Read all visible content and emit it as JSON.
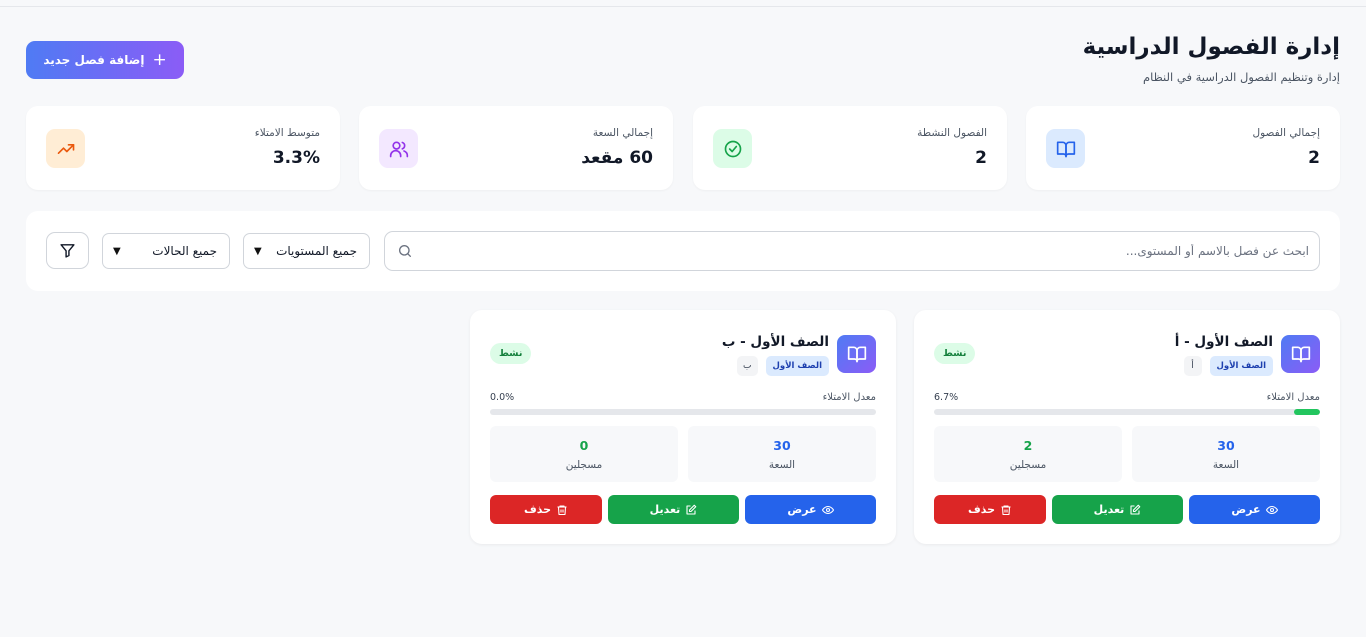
{
  "header": {
    "title": "إدارة الفصول الدراسية",
    "subtitle": "إدارة وتنظيم الفصول الدراسية في النظام",
    "add_button_label": "إضافة فصل جديد"
  },
  "stats": [
    {
      "label": "إجمالي الفصول",
      "value": "2",
      "icon": "book-open-icon",
      "color": "#2563eb",
      "bg": "#dbeafe"
    },
    {
      "label": "الفصول النشطة",
      "value": "2",
      "icon": "check-circle-icon",
      "color": "#16a34a",
      "bg": "#dcfce7"
    },
    {
      "label": "إجمالي السعة",
      "value": "60 مقعد",
      "icon": "users-icon",
      "color": "#9333ea",
      "bg": "#f3e8ff"
    },
    {
      "label": "متوسط الامتلاء",
      "value": "3.3%",
      "icon": "trending-up-icon",
      "color": "#ea580c",
      "bg": "#ffedd5"
    }
  ],
  "filters": {
    "search_placeholder": "ابحث عن فصل بالاسم أو المستوى...",
    "level_select": "جميع المستويات",
    "status_select": "جميع الحالات"
  },
  "classes": [
    {
      "name": "الصف الأول - أ",
      "level": "الصف الأول",
      "section": "أ",
      "status": "نشط",
      "occupancy_label": "معدل الامتلاء",
      "occupancy": "6.7%",
      "occupancy_fraction": 0.067,
      "capacity": "30",
      "capacity_label": "السعة",
      "enrolled": "2",
      "enrolled_label": "مسجلين",
      "actions": {
        "view": "عرض",
        "edit": "تعديل",
        "delete": "حذف"
      }
    },
    {
      "name": "الصف الأول - ب",
      "level": "الصف الأول",
      "section": "ب",
      "status": "نشط",
      "occupancy_label": "معدل الامتلاء",
      "occupancy": "0.0%",
      "occupancy_fraction": 0.0,
      "capacity": "30",
      "capacity_label": "السعة",
      "enrolled": "0",
      "enrolled_label": "مسجلين",
      "actions": {
        "view": "عرض",
        "edit": "تعديل",
        "delete": "حذف"
      }
    }
  ],
  "colors": {
    "accent_gradient_start": "#4f7bf4",
    "accent_gradient_end": "#8b5cf6",
    "view": "#2563eb",
    "edit": "#16a34a",
    "delete": "#dc2626",
    "progress_fill": "#22c55e"
  }
}
